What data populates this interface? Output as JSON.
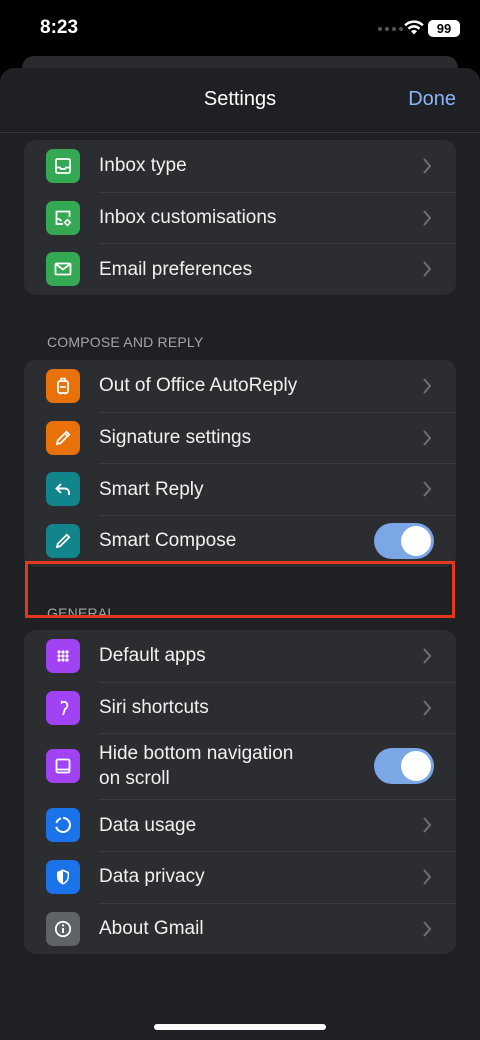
{
  "status_bar": {
    "time": "8:23",
    "battery": "99"
  },
  "nav": {
    "title": "Settings",
    "done": "Done"
  },
  "group1": [
    {
      "label": "Inbox type",
      "icon": "inbox-icon"
    },
    {
      "label": "Inbox customisations",
      "icon": "inbox-settings-icon"
    },
    {
      "label": "Email preferences",
      "icon": "mail-icon"
    }
  ],
  "sections": {
    "compose": "COMPOSE AND REPLY",
    "general": "GENERAL"
  },
  "group2": [
    {
      "label": "Out of Office AutoReply",
      "icon": "luggage-icon"
    },
    {
      "label": "Signature settings",
      "icon": "signature-pen-icon"
    },
    {
      "label": "Smart Reply",
      "icon": "reply-arrow-icon"
    },
    {
      "label": "Smart Compose",
      "icon": "pencil-icon",
      "toggle": true
    }
  ],
  "group3": [
    {
      "label": "Default apps",
      "icon": "apps-grid-icon"
    },
    {
      "label": "Siri shortcuts",
      "icon": "siri-shortcut-icon"
    },
    {
      "label": "Hide bottom navigation\non scroll",
      "icon": "bottom-bar-icon",
      "toggle": true
    },
    {
      "label": "Data usage",
      "icon": "data-usage-icon"
    },
    {
      "label": "Data privacy",
      "icon": "shield-icon"
    },
    {
      "label": "About Gmail",
      "icon": "info-icon"
    }
  ],
  "colors": {
    "green": "#34a853",
    "orange": "#e8710a",
    "teal": "#12848b",
    "purple": "#a142f4",
    "blue": "#1a73e8",
    "gray": "#5f6368",
    "accent": "#8ab4f8",
    "highlight": "#e03a1e",
    "toggle_on": "#7ba7e6"
  }
}
